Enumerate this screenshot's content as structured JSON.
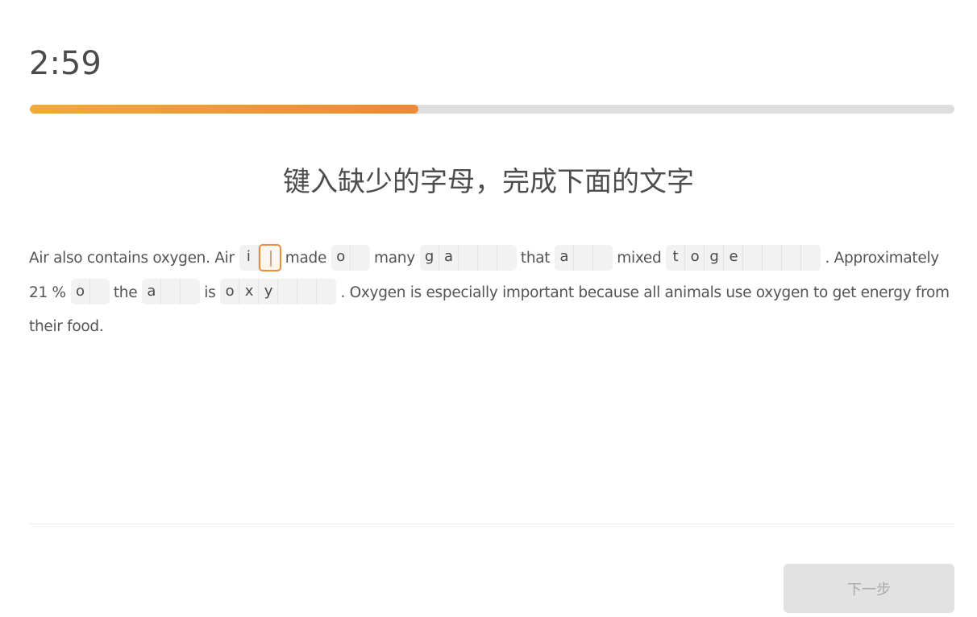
{
  "timer": "2:59",
  "progress": {
    "percent": 42,
    "colors": {
      "start": "#f0a93a",
      "end": "#ec8a35",
      "track": "#dedede"
    }
  },
  "instruction": "键入缺少的字母，完成下面的文字",
  "passage": [
    {
      "type": "text",
      "value": "Air also contains oxygen. Air"
    },
    {
      "type": "blank",
      "given": [
        "i"
      ],
      "missing": 1,
      "focused_index": 1
    },
    {
      "type": "text",
      "value": "made"
    },
    {
      "type": "blank",
      "given": [
        "o"
      ],
      "missing": 1
    },
    {
      "type": "text",
      "value": "many"
    },
    {
      "type": "blank",
      "given": [
        "g",
        "a"
      ],
      "missing": 3
    },
    {
      "type": "text",
      "value": "that"
    },
    {
      "type": "blank",
      "given": [
        "a"
      ],
      "missing": 2
    },
    {
      "type": "text",
      "value": "mixed"
    },
    {
      "type": "blank",
      "given": [
        "t",
        "o",
        "g",
        "e"
      ],
      "missing": 4
    },
    {
      "type": "text",
      "value": ". Approximately 21 %"
    },
    {
      "type": "blank",
      "given": [
        "o"
      ],
      "missing": 1
    },
    {
      "type": "text",
      "value": "the"
    },
    {
      "type": "blank",
      "given": [
        "a"
      ],
      "missing": 2
    },
    {
      "type": "text",
      "value": "is"
    },
    {
      "type": "blank",
      "given": [
        "o",
        "x",
        "y"
      ],
      "missing": 3
    },
    {
      "type": "text",
      "value": ". Oxygen is especially important because all animals use oxygen to get energy from their food."
    }
  ],
  "footer": {
    "next_label": "下一步",
    "next_enabled": false
  },
  "accent_color": "#ec8a35"
}
